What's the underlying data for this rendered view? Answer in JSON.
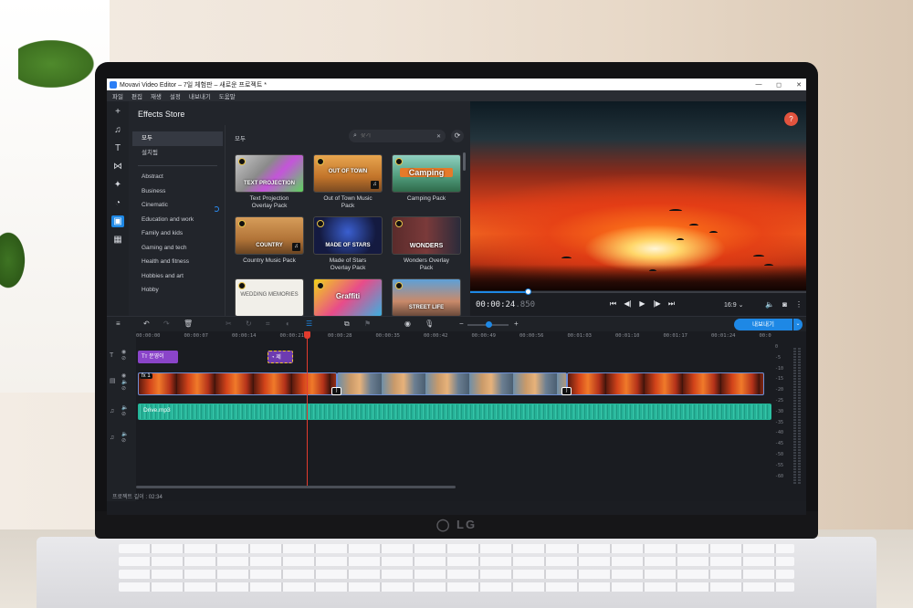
{
  "window": {
    "title": "Movavi Video Editor – 7일 체험판 – 새로운 프로젝트 *",
    "controls": [
      "—",
      "◻",
      "✕"
    ]
  },
  "menu": [
    "파일",
    "편집",
    "재생",
    "설정",
    "내보내기",
    "도움말"
  ],
  "tool_rail": {
    "icons": [
      "plus-icon",
      "music-note-icon",
      "text-icon",
      "transition-icon",
      "magic-wand-icon",
      "clock-icon",
      "store-icon",
      "apps-icon"
    ],
    "glyphs": [
      "+",
      "♫",
      "T",
      "⋈",
      "✦",
      "◔",
      "▣",
      "▦"
    ]
  },
  "effects_store": {
    "title": "Effects Store",
    "tabs": [
      "모두",
      "설치됨"
    ],
    "categories": [
      "Abstract",
      "Business",
      "Cinematic",
      "Education and work",
      "Family and kids",
      "Gaming and tech",
      "Health and fitness",
      "Hobbies and art",
      "Hobby"
    ],
    "grid_heading": "모두",
    "search": {
      "placeholder": "찾기",
      "value": ""
    },
    "cards": [
      {
        "label": "Text Projection\nOverlay Pack",
        "thumb_text": "TEXT PROJECTION"
      },
      {
        "label": "Out of Town Music\nPack",
        "thumb_text": "OUT OF TOWN"
      },
      {
        "label": "Camping Pack",
        "thumb_text": "Camping"
      },
      {
        "label": "Country Music Pack",
        "thumb_text": "COUNTRY"
      },
      {
        "label": "Made of Stars\nOverlay Pack",
        "thumb_text": "MADE OF STARS"
      },
      {
        "label": "Wonders Overlay\nPack",
        "thumb_text": "WONDERS"
      },
      {
        "label": "",
        "thumb_text": "WEDDING MEMORIES"
      },
      {
        "label": "",
        "thumb_text": "Graffiti"
      },
      {
        "label": "",
        "thumb_text": "STREET LIFE"
      }
    ]
  },
  "preview": {
    "help": "?",
    "timecode": "00:00:24",
    "timecode_ms": ".850",
    "progress": 0.17,
    "aspect": "16:9 ⌄",
    "transport": [
      "⏮",
      "◀|",
      "▶",
      "|▶",
      "⏭"
    ]
  },
  "timeline_toolbar": {
    "export_label": "내보내기",
    "export_dropdown": "⌄",
    "zoom": 0.5
  },
  "timeline": {
    "ruler": [
      "00:00:00",
      "00:00:07",
      "00:00:14",
      "00:00:21",
      "00:00:28",
      "00:00:35",
      "00:00:42",
      "00:00:49",
      "00:00:56",
      "00:01:03",
      "00:01:10",
      "00:01:17",
      "00:01:24",
      "00:0"
    ],
    "title_clip": "Tт 문영이",
    "sticker_clip": "◔ 제",
    "fx_badge": "fx 1",
    "audio_clip": "Drive.mp3",
    "vu_scale": [
      "0",
      "-5",
      "-10",
      "-15",
      "-20",
      "-25",
      "-30",
      "-35",
      "-40",
      "-45",
      "-50",
      "-55",
      "-60"
    ],
    "project_length": "프로젝트 길이 : 02:34"
  },
  "colors": {
    "accent": "#1e88e5",
    "title_clip": "#8a44c9",
    "audio_clip": "#1aa58c",
    "playhead": "#e23b2e",
    "help": "#e2533e"
  }
}
